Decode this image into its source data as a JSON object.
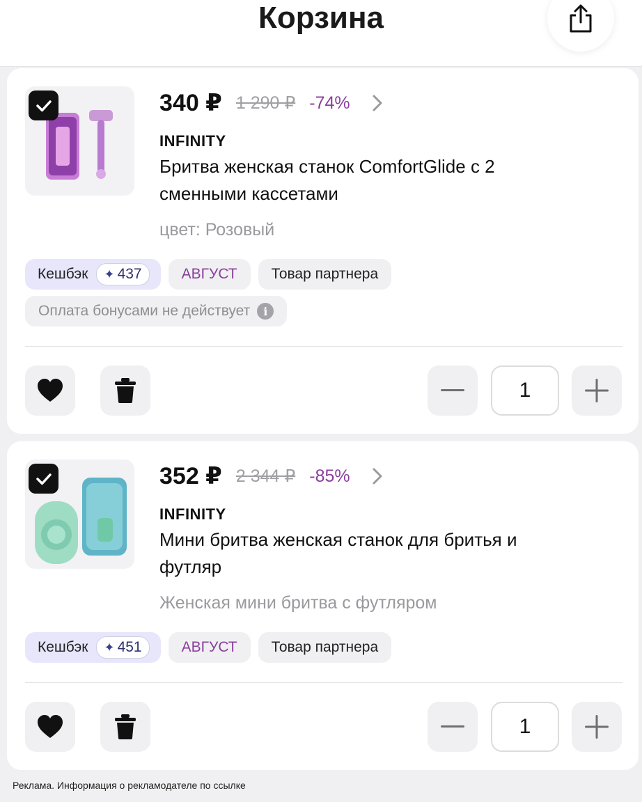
{
  "header": {
    "title": "Корзина",
    "share_icon": "share-icon"
  },
  "items": [
    {
      "selected": true,
      "price": "340 ₽",
      "old_price": "1 290 ₽",
      "discount": "-74%",
      "brand": "INFINITY",
      "title": "Бритва женская станок ComfortGlide с 2 сменными кассетами",
      "variant": "цвет: Розовый",
      "cashback_label": "Кешбэк",
      "cashback_value": "437",
      "promo": "АВГУСТ",
      "partner": "Товар партнера",
      "bonus_note": "Оплата бонусами не действует",
      "quantity": "1",
      "image_icon": "pink-razor-product-image"
    },
    {
      "selected": true,
      "price": "352 ₽",
      "old_price": "2 344 ₽",
      "discount": "-85%",
      "brand": "INFINITY",
      "title": "Мини бритва женская станок для бритья и футляр",
      "variant": "Женская мини бритва с футляром",
      "cashback_label": "Кешбэк",
      "cashback_value": "451",
      "promo": "АВГУСТ",
      "partner": "Товар партнера",
      "quantity": "1",
      "image_icon": "mint-mini-razor-product-image"
    }
  ],
  "footer": {
    "ad_note": "Реклама. Информация о рекламодателе по ссылке"
  },
  "colors": {
    "background": "#f0f0f2",
    "accent_purple": "#8a3f9c",
    "cashback_bg": "#e7e6fb",
    "checkbox": "#111111"
  }
}
